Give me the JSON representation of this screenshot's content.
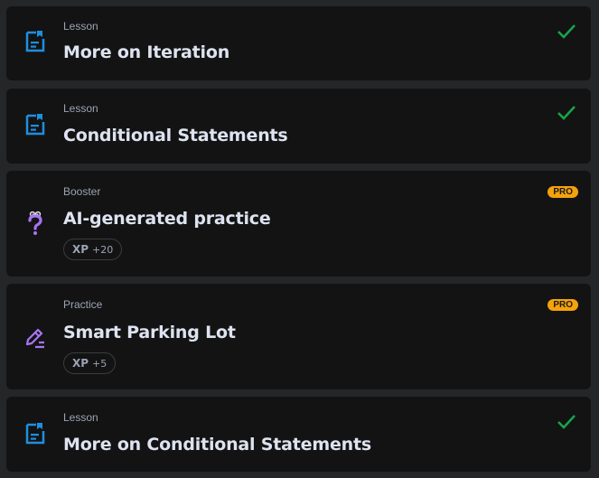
{
  "items": [
    {
      "kind": "Lesson",
      "title": "More on Iteration",
      "icon": "lesson-doc-icon",
      "status": "completed"
    },
    {
      "kind": "Lesson",
      "title": "Conditional Statements",
      "icon": "lesson-doc-icon",
      "status": "completed"
    },
    {
      "kind": "Booster",
      "title": "AI-generated practice",
      "icon": "ai-question-icon",
      "badge": "PRO",
      "xp_label": "XP",
      "xp_value": "+20"
    },
    {
      "kind": "Practice",
      "title": "Smart Parking Lot",
      "icon": "pencil-practice-icon",
      "badge": "PRO",
      "xp_label": "XP",
      "xp_value": "+5"
    },
    {
      "kind": "Lesson",
      "title": "More on Conditional Statements",
      "icon": "lesson-doc-icon",
      "status": "completed"
    }
  ],
  "colors": {
    "background": "#252628",
    "card": "#131313",
    "lesson_icon": "#1e8fe0",
    "practice_icon": "#a874f5",
    "check": "#18a34a",
    "pro_badge": "#f5a20b"
  }
}
